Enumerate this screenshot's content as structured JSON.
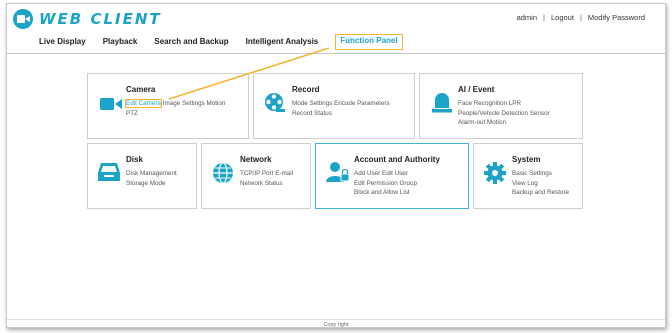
{
  "app": {
    "logo_text": "WEB CLIENT"
  },
  "account": {
    "user": "admin",
    "separator": "|",
    "logout": "Logout",
    "modify_password": "Modify Password"
  },
  "nav": {
    "live_display": "Live Display",
    "playback": "Playback",
    "search_backup": "Search and Backup",
    "intelligent_analysis": "Intelligent Analysis",
    "function_panel": "Function Panel"
  },
  "cards": {
    "camera": {
      "title": "Camera",
      "edit_camera": "Edit Camera",
      "rest": "Image Settings Motion",
      "line2": "PTZ"
    },
    "record": {
      "title": "Record",
      "line1": "Mode Settings Encode Parameters",
      "line2": "Record Status"
    },
    "ai_event": {
      "title": "AI / Event",
      "line1": "Face Recognition LPR",
      "line2": "People/Vehicle Detection Sensor",
      "line3": "Alarm-out Motion"
    },
    "disk": {
      "title": "Disk",
      "line1": "Disk Management",
      "line2": "Storage Mode"
    },
    "network": {
      "title": "Network",
      "line1": "TCP/IP Port E-mail",
      "line2": "Network Status"
    },
    "account_authority": {
      "title": "Account and Authority",
      "line1": "Add User Edit User",
      "line2": "Edit Permission Group",
      "line3": "Block and Allow List"
    },
    "system": {
      "title": "System",
      "line1": "Basic Settings",
      "line2": "View Log",
      "line3": "Backup and Restore"
    }
  },
  "footer": {
    "copyright": "Copy right"
  },
  "colors": {
    "accent": "#1ba4c8",
    "highlight": "#f3b52e"
  }
}
